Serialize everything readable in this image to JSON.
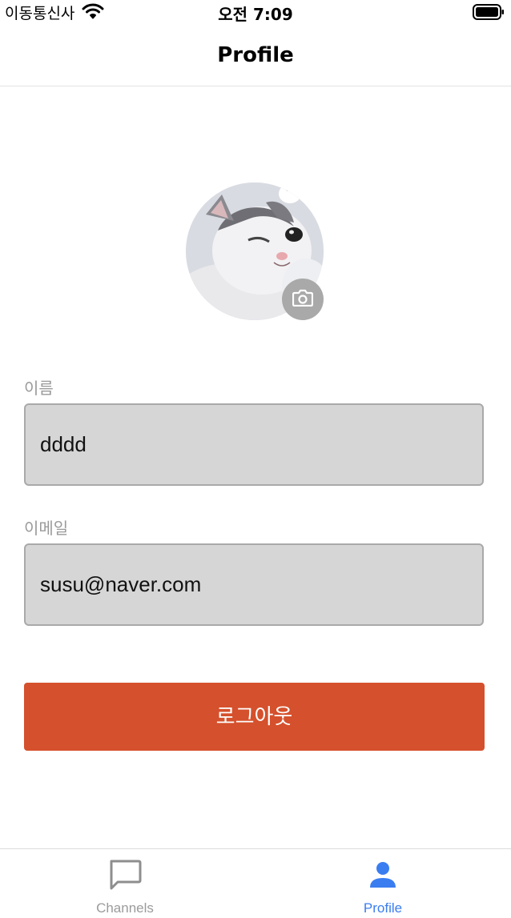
{
  "status_bar": {
    "carrier": "이동통신사",
    "time": "오전 7:09"
  },
  "header": {
    "title": "Profile"
  },
  "form": {
    "name_label": "이름",
    "name_value": "dddd",
    "email_label": "이메일",
    "email_value": "susu@naver.com"
  },
  "logout": {
    "label": "로그아웃"
  },
  "tabs": [
    {
      "label": "Channels",
      "icon": "chat-bubble-icon",
      "active": false
    },
    {
      "label": "Profile",
      "icon": "person-icon",
      "active": true
    }
  ],
  "colors": {
    "accent": "#d5502c",
    "active_tab": "#3a7df0",
    "inactive_tab": "#9b9b9b",
    "input_bg": "#d6d6d6"
  }
}
